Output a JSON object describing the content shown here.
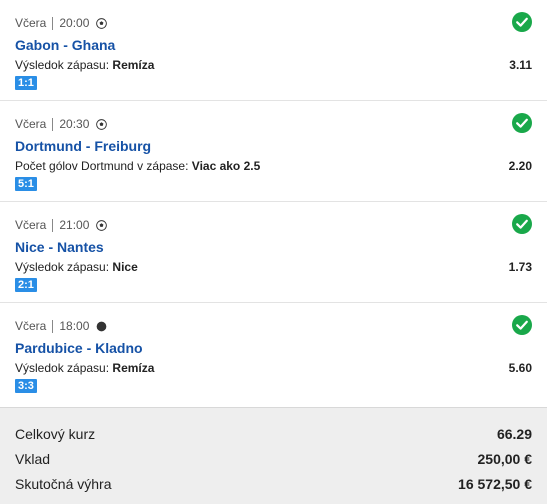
{
  "bets": [
    {
      "day": "Včera",
      "time": "20:00",
      "sport_icon": "soccer-ball-icon",
      "match": "Gabon - Ghana",
      "market_label": "Výsledok zápasu:",
      "selection": "Remíza",
      "odd": "3.11",
      "score": "1:1",
      "status": "won"
    },
    {
      "day": "Včera",
      "time": "20:30",
      "sport_icon": "soccer-ball-icon",
      "match": "Dortmund - Freiburg",
      "market_label": "Počet gólov Dortmund v zápase:",
      "selection": "Viac ako 2.5",
      "odd": "2.20",
      "score": "5:1",
      "status": "won"
    },
    {
      "day": "Včera",
      "time": "21:00",
      "sport_icon": "soccer-ball-icon",
      "match": "Nice - Nantes",
      "market_label": "Výsledok zápasu:",
      "selection": "Nice",
      "odd": "1.73",
      "score": "2:1",
      "status": "won"
    },
    {
      "day": "Včera",
      "time": "18:00",
      "sport_icon": "hockey-puck-icon",
      "match": "Pardubice - Kladno",
      "market_label": "Výsledok zápasu:",
      "selection": "Remíza",
      "odd": "5.60",
      "score": "3:3",
      "status": "won"
    }
  ],
  "summary": {
    "total_odds_label": "Celkový kurz",
    "total_odds": "66.29",
    "stake_label": "Vklad",
    "stake": "250,00 €",
    "payout_label": "Skutočná výhra",
    "payout": "16 572,50 €"
  },
  "colors": {
    "match_link": "#1652a6",
    "score_badge": "#2a8ee6",
    "won_check": "#19a84a",
    "summary_bg": "#eeeeee"
  }
}
